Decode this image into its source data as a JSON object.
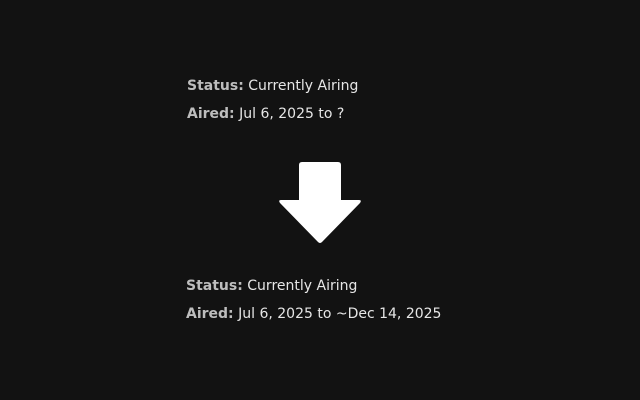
{
  "before": {
    "status_label": "Status:",
    "status_value": "Currently Airing",
    "aired_label": "Aired:",
    "aired_value": "Jul 6, 2025 to ?"
  },
  "after": {
    "status_label": "Status:",
    "status_value": "Currently Airing",
    "aired_label": "Aired:",
    "aired_value": "Jul 6, 2025 to ~Dec 14, 2025"
  },
  "arrow": {
    "icon": "arrow-down-icon",
    "color": "#ffffff"
  },
  "colors": {
    "background": "#121212",
    "label": "#bdbdbd",
    "value": "#e6e6e6"
  }
}
